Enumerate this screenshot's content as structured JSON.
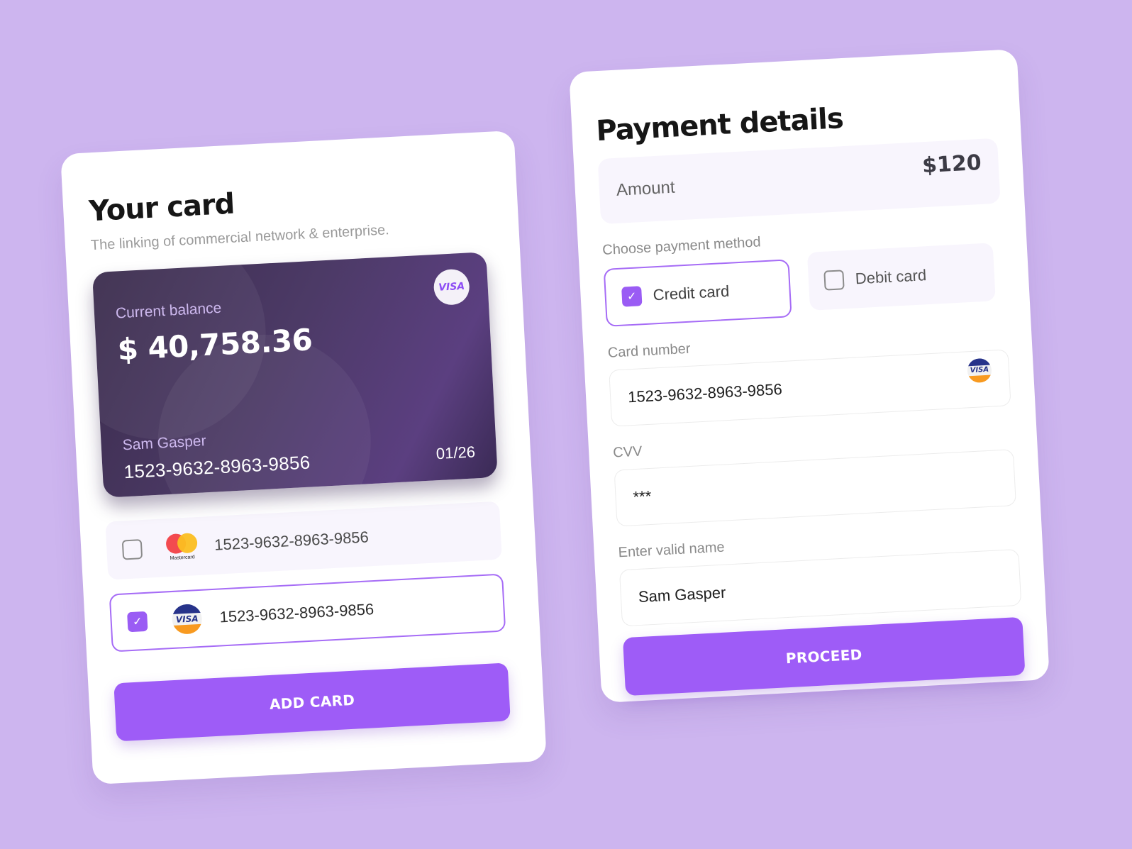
{
  "your_card": {
    "title": "Your card",
    "subtitle": "The linking of commercial  network & enterprise.",
    "balance_card": {
      "balance_label": "Current balance",
      "balance": "$ 40,758.36",
      "brand": "VISA",
      "holder_name": "Sam Gasper",
      "number": "1523-9632-8963-9856",
      "expiry": "01/26"
    },
    "saved_cards": [
      {
        "brand": "Mastercard",
        "brand_label": "Mastercard",
        "number": "1523-9632-8963-9856",
        "checked": false
      },
      {
        "brand": "VISA",
        "brand_label": "VISA",
        "number": "1523-9632-8963-9856",
        "checked": true
      }
    ],
    "add_card_label": "ADD CARD"
  },
  "payment_details": {
    "title": "Payment details",
    "amount_label": "Amount",
    "amount_value": "$120",
    "method_label": "Choose payment method",
    "methods": [
      {
        "label": "Credit card",
        "checked": true
      },
      {
        "label": "Debit card",
        "checked": false
      }
    ],
    "card_number_label": "Card number",
    "card_number_value": "1523-9632-8963-9856",
    "card_number_brand": "VISA",
    "cvv_label": "CVV",
    "cvv_value": "***",
    "name_label": "Enter valid name",
    "name_value": "Sam Gasper",
    "proceed_label": "PROCEED"
  },
  "colors": {
    "background": "#cdb5ef",
    "accent": "#9e5cf7",
    "card_dark": "#4c3a66"
  },
  "icons": {
    "check": "✓"
  }
}
